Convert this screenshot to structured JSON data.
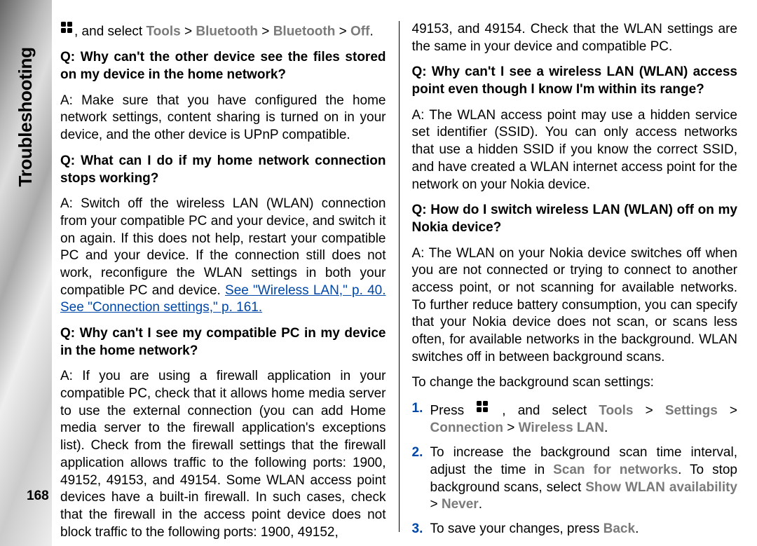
{
  "section_title": "Troubleshooting",
  "page_number": "168",
  "col1": {
    "intro_pre": ", and select ",
    "intro_path": [
      "Tools",
      "Bluetooth",
      "Bluetooth",
      "Off"
    ],
    "intro_suffix": ".",
    "q1": "Q: Why can't the other device see the files stored on my device in the home network?",
    "a1": "A: Make sure that you have configured the home network settings, content sharing is turned on in your device, and the other device is UPnP compatible.",
    "q2": "Q: What can I do if my home network connection stops working?",
    "a2_pre": "A: Switch off the wireless LAN (WLAN) connection from your compatible PC and your device, and switch it on again. If this does not help, restart your compatible PC and your device. If the connection still does not work, reconfigure the WLAN settings in both your compatible PC and device. ",
    "a2_link1": "See \"Wireless LAN,\" p. 40.",
    "a2_link2": " See \"Connection settings,\" p. 161.",
    "q3": "Q: Why can't I see my compatible PC in my device in the home network?",
    "a3": "A: If you are using a firewall application in your compatible PC, check that it allows home media server to use the external connection (you can add Home media server to the firewall application's exceptions list). Check from the firewall settings that the firewall application allows traffic to the following ports: 1900, 49152, 49153, and 49154. Some WLAN access point devices have a built-in firewall. In such cases, check that the firewall in the access point device does not block traffic to the following ports: 1900, 49152,"
  },
  "col2": {
    "cont": "49153, and 49154. Check that the WLAN settings are the same in your device and compatible PC.",
    "q4": "Q: Why can't I see a wireless LAN (WLAN) access point even though I know I'm within its range?",
    "a4": "A: The WLAN access point may use a hidden service set identifier (SSID). You can only access networks that use a hidden SSID if you know the correct SSID, and have created a WLAN internet access point for the network on your Nokia device.",
    "q5": "Q: How do I switch wireless LAN (WLAN) off on my Nokia device?",
    "a5": "A: The WLAN on your Nokia device switches off when you are not connected or trying to connect to another access point, or not scanning for available networks. To further reduce battery consumption, you can specify that your Nokia device does not scan, or scans less often, for available networks in the background. WLAN switches off in between background scans.",
    "change_intro": "To change the background scan settings:",
    "steps": {
      "s1_num": "1.",
      "s1_pre": "Press ",
      "s1_mid": " , and select ",
      "s1_path": [
        "Tools",
        "Settings",
        "Connection",
        "Wireless LAN"
      ],
      "s1_suffix": ".",
      "s2_num": "2.",
      "s2_pre": "To increase the background scan time interval, adjust the time in ",
      "s2_m1": "Scan for networks",
      "s2_mid": ". To stop background scans, select ",
      "s2_m2": "Show WLAN availability",
      "s2_sep": " > ",
      "s2_m3": "Never",
      "s2_suffix": ".",
      "s3_num": "3.",
      "s3_pre": "To save your changes, press ",
      "s3_m1": "Back",
      "s3_suffix": "."
    }
  },
  "gt_symbol": " > "
}
